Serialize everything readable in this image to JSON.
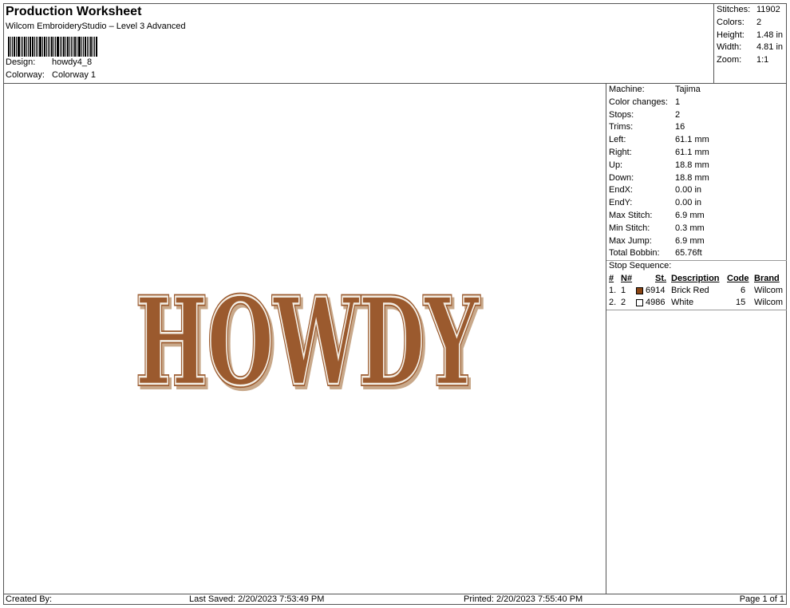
{
  "header": {
    "title": "Production Worksheet",
    "subtitle": "Wilcom EmbroideryStudio – Level 3 Advanced",
    "design_label": "Design:",
    "design_value": "howdy4_8",
    "colorway_label": "Colorway:",
    "colorway_value": "Colorway 1"
  },
  "summary": [
    {
      "label": "Stitches:",
      "value": "11902"
    },
    {
      "label": "Colors:",
      "value": "2"
    },
    {
      "label": "Height:",
      "value": "1.48 in"
    },
    {
      "label": "Width:",
      "value": "4.81 in"
    },
    {
      "label": "Zoom:",
      "value": "1:1"
    }
  ],
  "design": {
    "text": "HOWDY",
    "fill_color": "#9B5A2E",
    "outline_color": "#F4EFE6"
  },
  "machine_info": [
    {
      "label": "Machine:",
      "value": "Tajima"
    },
    {
      "label": "Color changes:",
      "value": "1"
    },
    {
      "label": "Stops:",
      "value": "2"
    },
    {
      "label": "Trims:",
      "value": "16"
    },
    {
      "label": "Left:",
      "value": "61.1 mm"
    },
    {
      "label": "Right:",
      "value": "61.1 mm"
    },
    {
      "label": "Up:",
      "value": "18.8 mm"
    },
    {
      "label": "Down:",
      "value": "18.8 mm"
    },
    {
      "label": "EndX:",
      "value": "0.00 in"
    },
    {
      "label": "EndY:",
      "value": "0.00 in"
    },
    {
      "label": "Max Stitch:",
      "value": "6.9 mm"
    },
    {
      "label": "Min Stitch:",
      "value": "0.3 mm"
    },
    {
      "label": "Max Jump:",
      "value": "6.9 mm"
    },
    {
      "label": "Total Bobbin:",
      "value": "65.76ft"
    }
  ],
  "stop_sequence": {
    "title": "Stop Sequence:",
    "columns": [
      "#",
      "N#",
      "St.",
      "Description",
      "Code",
      "Brand"
    ],
    "rows": [
      {
        "num": "1.",
        "n": "1",
        "color": "#8B4513",
        "st": "6914",
        "description": "Brick Red",
        "code": "6",
        "brand": "Wilcom"
      },
      {
        "num": "2.",
        "n": "2",
        "color": "#FFFFFF",
        "st": "4986",
        "description": "White",
        "code": "15",
        "brand": "Wilcom"
      }
    ]
  },
  "footer": {
    "created_by": "Created By:",
    "last_saved": "Last Saved: 2/20/2023 7:53:49 PM",
    "printed": "Printed: 2/20/2023 7:55:40 PM",
    "page": "Page 1 of 1"
  }
}
